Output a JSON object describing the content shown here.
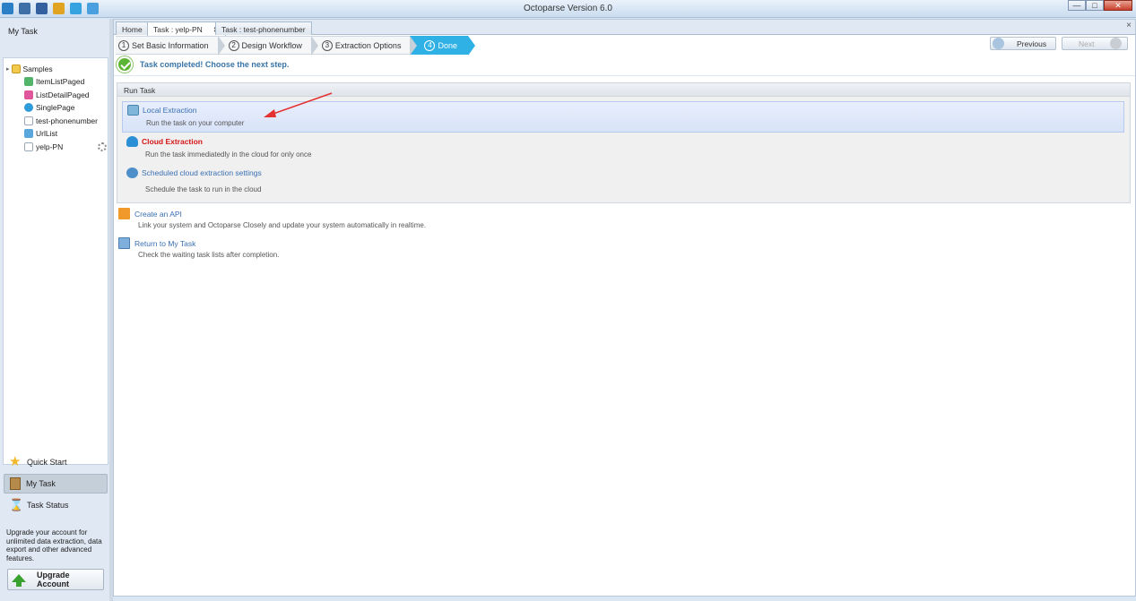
{
  "app": {
    "title": "Octoparse Version 6.0"
  },
  "window_controls": {
    "minimize": "—",
    "maximize": "□",
    "close": "✕"
  },
  "sidebar": {
    "title": "My Task",
    "tree": [
      {
        "label": "Samples",
        "icon": "folder-icon",
        "level": 0
      },
      {
        "label": "ItemListPaged",
        "icon": "task-green-icon",
        "level": 1
      },
      {
        "label": "ListDetailPaged",
        "icon": "task-pink-icon",
        "level": 1
      },
      {
        "label": "SinglePage",
        "icon": "task-blue-icon",
        "level": 1
      },
      {
        "label": "test-phonenumber",
        "icon": "task-doc-icon",
        "level": 1
      },
      {
        "label": "UrlList",
        "icon": "task-blue-icon",
        "level": 1
      },
      {
        "label": "yelp-PN",
        "icon": "task-doc-icon",
        "level": 1
      }
    ],
    "nav": [
      {
        "label": "Quick Start",
        "icon": "star-icon"
      },
      {
        "label": "My Task",
        "icon": "book-icon"
      },
      {
        "label": "Task Status",
        "icon": "hourglass-icon"
      }
    ],
    "upgrade_text": "Upgrade your account for unlimited data extraction, data export and other advanced features.",
    "upgrade_button": "Upgrade Account"
  },
  "tabs": [
    {
      "label": "Home"
    },
    {
      "label": "Task : yelp-PN",
      "close": "✖"
    },
    {
      "label": "Task : test-phonenumber"
    }
  ],
  "panel_close": "×",
  "steps": [
    {
      "num": "1",
      "label": "Set Basic Information"
    },
    {
      "num": "2",
      "label": "Design Workflow"
    },
    {
      "num": "3",
      "label": "Extraction Options"
    },
    {
      "num": "4",
      "label": "Done"
    }
  ],
  "buttons": {
    "previous": "Previous",
    "next": "Next"
  },
  "status": {
    "completed": "Task completed! Choose the next step."
  },
  "run_task": {
    "header": "Run Task",
    "options": [
      {
        "title": "Local Extraction",
        "desc": "Run the task on your computer"
      },
      {
        "title": "Cloud Extraction",
        "desc": "Run the task immediatedly in the cloud for only once"
      },
      {
        "title": "Scheduled cloud extraction settings",
        "desc": "Schedule the task to run in the cloud"
      }
    ]
  },
  "links": [
    {
      "title": "Create an API",
      "desc": "Link your system and Octoparse Closely and update your system automatically in realtime."
    },
    {
      "title": "Return to My Task",
      "desc": "Check the waiting task lists after completion."
    }
  ],
  "colors": {
    "accent": "#2fb1e6",
    "link": "#3a6fb3",
    "cloud_red": "#d51616",
    "success": "#5db535"
  }
}
